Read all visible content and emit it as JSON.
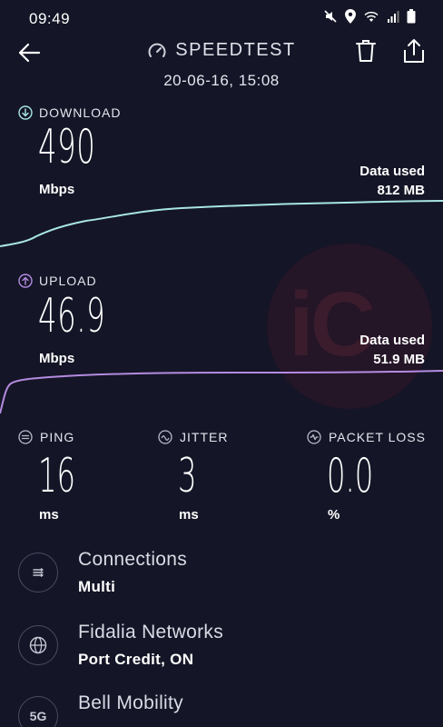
{
  "status_bar": {
    "time": "09:49",
    "icons": [
      "mute-icon",
      "location-icon",
      "wifi-icon",
      "signal-icon",
      "battery-icon"
    ]
  },
  "header": {
    "title": "SPEEDTEST",
    "date": "20-06-16, 15:08",
    "icons": [
      "back-arrow-icon",
      "speedometer-icon",
      "trash-icon",
      "share-icon"
    ]
  },
  "download": {
    "label": "DOWNLOAD",
    "value": "490",
    "unit": "Mbps",
    "data_used_label": "Data used",
    "data_used_value": "812 MB",
    "color": "#a8e6e3"
  },
  "upload": {
    "label": "UPLOAD",
    "value": "46.9",
    "unit": "Mbps",
    "data_used_label": "Data used",
    "data_used_value": "51.9 MB",
    "color": "#b48be0"
  },
  "stats": {
    "ping": {
      "label": "PING",
      "value": "16",
      "unit": "ms"
    },
    "jitter": {
      "label": "JITTER",
      "value": "3",
      "unit": "ms"
    },
    "packet_loss": {
      "label": "PACKET LOSS",
      "value": "0.0",
      "unit": "%"
    }
  },
  "info": {
    "connections": {
      "title": "Connections",
      "value": "Multi",
      "icon": "connections-icon"
    },
    "provider": {
      "title": "Fidalia Networks",
      "value": "Port Credit, ON",
      "icon": "globe-icon"
    },
    "carrier": {
      "title": "Bell Mobility",
      "icon_text": "5G"
    }
  },
  "watermark_text": "iC",
  "colors": {
    "background": "#141526",
    "accent_download": "#a8e6e3",
    "accent_upload": "#b48be0"
  }
}
